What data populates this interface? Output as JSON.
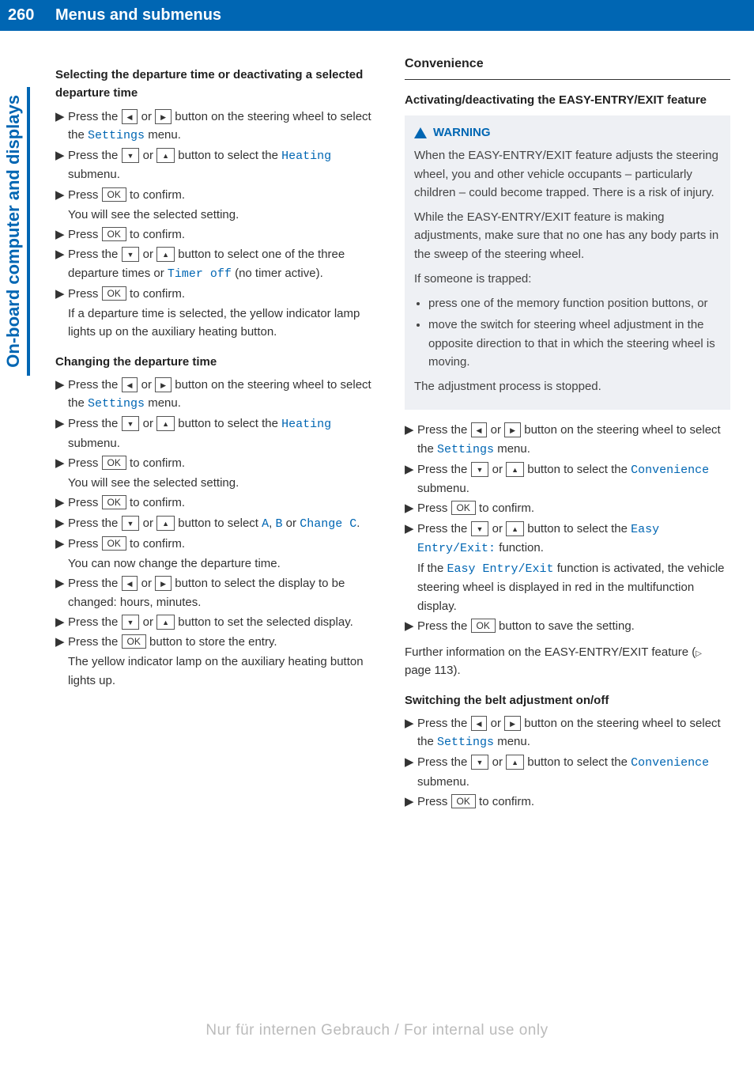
{
  "page_number": "260",
  "header_title": "Menus and submenus",
  "side_tab": "On-board computer and displays",
  "buttons": {
    "ok": "OK"
  },
  "mono": {
    "settings": "Settings",
    "heating": "Heating",
    "timer_off": "Timer off",
    "a": "A",
    "b": "B",
    "change_c": "Change C",
    "convenience": "Convenience",
    "easy_entry_exit_colon": "Easy Entry/Exit:",
    "easy_entry_exit": "Easy Entry/Exit"
  },
  "left": {
    "h1": "Selecting the departure time or deactivating a selected departure time",
    "s1a": "Press the ",
    "s1b": " or ",
    "s1c": " button on the steering wheel to select the ",
    "s1d": " menu.",
    "s2a": "Press the ",
    "s2b": " or ",
    "s2c": " button to select the ",
    "s2d": " submenu.",
    "s3a": "Press ",
    "s3b": " to confirm.",
    "s3r": "You will see the selected setting.",
    "s4a": "Press ",
    "s4b": " to confirm.",
    "s5a": "Press the ",
    "s5b": " or ",
    "s5c": " button to select one of the three departure times or ",
    "s5d": " (no timer active).",
    "s6a": "Press ",
    "s6b": " to confirm.",
    "s6r": "If a departure time is selected, the yellow indicator lamp lights up on the auxiliary heating button.",
    "h2": "Changing the departure time",
    "c1a": "Press the ",
    "c1b": " or ",
    "c1c": " button on the steering wheel to select the ",
    "c1d": " menu.",
    "c2a": "Press the ",
    "c2b": " or ",
    "c2c": " button to select the ",
    "c2d": " submenu.",
    "c3a": "Press ",
    "c3b": " to confirm.",
    "c3r": "You will see the selected setting.",
    "c4a": "Press ",
    "c4b": " to confirm.",
    "c5a": "Press the ",
    "c5b": " or ",
    "c5c": " button to select ",
    "c5d": ", ",
    "c5e": " or ",
    "c5f": ".",
    "c6a": "Press ",
    "c6b": " to confirm.",
    "c6r": "You can now change the departure time.",
    "c7a": "Press the ",
    "c7b": " or ",
    "c7c": " button to select the display to be changed: hours, minutes.",
    "c8a": "Press the ",
    "c8b": " or ",
    "c8c": " button to set the selected display.",
    "c9a": "Press the ",
    "c9b": " button to store the entry.",
    "c9r": "The yellow indicator lamp on the auxiliary heating button lights up."
  },
  "right": {
    "conv_title": "Convenience",
    "h1": "Activating/deactivating the EASY-ENTRY/EXIT feature",
    "warn_label": "WARNING",
    "warn_p1": "When the EASY-ENTRY/EXIT feature adjusts the steering wheel, you and other vehicle occupants – particularly children – could become trapped. There is a risk of injury.",
    "warn_p2": "While the EASY-ENTRY/EXIT feature is making adjustments, make sure that no one has any body parts in the sweep of the steering wheel.",
    "warn_p3": "If someone is trapped:",
    "warn_li1": "press one of the memory function position buttons, or",
    "warn_li2": "move the switch for steering wheel adjustment in the opposite direction to that in which the steering wheel is moving.",
    "warn_p4": "The adjustment process is stopped.",
    "e1a": "Press the ",
    "e1b": " or ",
    "e1c": " button on the steering wheel to select the ",
    "e1d": " menu.",
    "e2a": "Press the ",
    "e2b": " or ",
    "e2c": " button to select the ",
    "e2d": " submenu.",
    "e3a": "Press ",
    "e3b": " to confirm.",
    "e4a": "Press the ",
    "e4b": " or ",
    "e4c": " button to select the ",
    "e4d": " function.",
    "e4r1": "If the ",
    "e4r2": " function is activated, the vehicle steering wheel is displayed in red in the multifunction display.",
    "e5a": "Press the ",
    "e5b": " button to save the setting.",
    "further_a": "Further information on the EASY-ENTRY/EXIT feature (",
    "further_page": " page 113).",
    "h2": "Switching the belt adjustment on/off",
    "b1a": "Press the ",
    "b1b": " or ",
    "b1c": " button on the steering wheel to select the ",
    "b1d": " menu.",
    "b2a": "Press the ",
    "b2b": " or ",
    "b2c": " button to select the ",
    "b2d": " submenu.",
    "b3a": "Press ",
    "b3b": " to confirm."
  },
  "watermark": "Nur für internen Gebrauch / For internal use only"
}
